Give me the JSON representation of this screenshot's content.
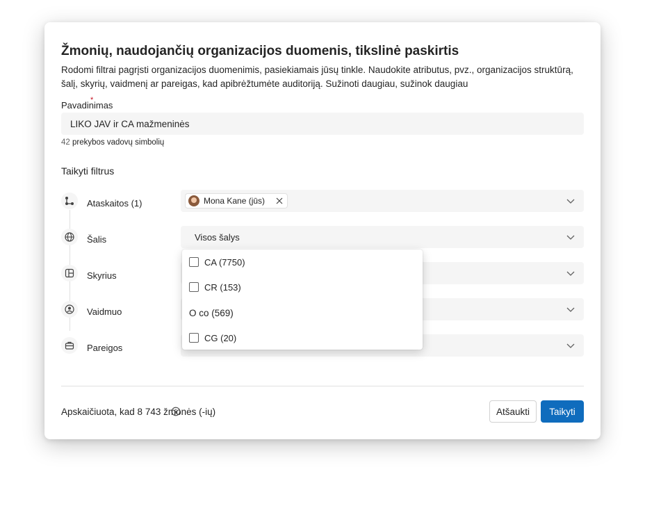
{
  "dialog": {
    "title": "Žmonių, naudojančių organizacijos duomenis, tikslinė paskirtis",
    "description_line1": "Rodomi filtrai pagrįsti organizacijos duomenimis, pasiekiamais jūsų tinkle. Naudokite atributus, pvz., organizacijos struktūrą,",
    "description_line2": "šalį, skyrių, vaidmenį ar pareigas, kad apibrėžtumėte auditoriją. Sužinoti daugiau, sužinok daugiau"
  },
  "name_field": {
    "label": "Pavadinimas",
    "required_mark": "*",
    "value": "LIKO JAV ir CA mažmeninės",
    "counter_num": "42",
    "counter_text": "prekybos vadovų simbolių"
  },
  "filters": {
    "heading": "Taikyti filtrus",
    "items": [
      {
        "label": "Ataskaitos (1)",
        "icon": "org-chart-icon",
        "chip_label": "Mona Kane (jūs)"
      },
      {
        "label": "Šalis",
        "icon": "globe-icon",
        "value": "Visos šalys"
      },
      {
        "label": "Skyrius",
        "icon": "layout-icon",
        "value": ""
      },
      {
        "label": "Vaidmuo",
        "icon": "person-circle-icon",
        "value": ""
      },
      {
        "label": "Pareigos",
        "icon": "briefcase-icon",
        "value": ""
      }
    ]
  },
  "country_dropdown": {
    "options": [
      {
        "label": "CA (7750)",
        "checkbox": true
      },
      {
        "label": "CR (153)",
        "checkbox": true
      },
      {
        "label": "O co (569)",
        "checkbox": false
      },
      {
        "label": "CG (20)",
        "checkbox": true
      }
    ]
  },
  "footer": {
    "estimate": "Apskaičiuota, kad 8 743 žmonės (-ių)",
    "cancel_label": "Atšaukti",
    "apply_label": "Taikyti"
  },
  "colors": {
    "accent": "#0f6cbd",
    "required": "#c50f1f",
    "field_bg": "#f5f5f5"
  }
}
